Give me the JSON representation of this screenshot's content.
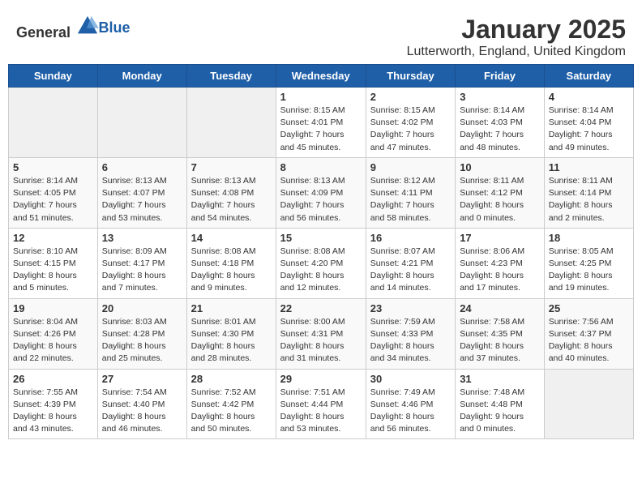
{
  "logo": {
    "general": "General",
    "blue": "Blue"
  },
  "title": "January 2025",
  "location": "Lutterworth, England, United Kingdom",
  "days_of_week": [
    "Sunday",
    "Monday",
    "Tuesday",
    "Wednesday",
    "Thursday",
    "Friday",
    "Saturday"
  ],
  "weeks": [
    [
      {
        "day": "",
        "info": ""
      },
      {
        "day": "",
        "info": ""
      },
      {
        "day": "",
        "info": ""
      },
      {
        "day": "1",
        "info": "Sunrise: 8:15 AM\nSunset: 4:01 PM\nDaylight: 7 hours\nand 45 minutes."
      },
      {
        "day": "2",
        "info": "Sunrise: 8:15 AM\nSunset: 4:02 PM\nDaylight: 7 hours\nand 47 minutes."
      },
      {
        "day": "3",
        "info": "Sunrise: 8:14 AM\nSunset: 4:03 PM\nDaylight: 7 hours\nand 48 minutes."
      },
      {
        "day": "4",
        "info": "Sunrise: 8:14 AM\nSunset: 4:04 PM\nDaylight: 7 hours\nand 49 minutes."
      }
    ],
    [
      {
        "day": "5",
        "info": "Sunrise: 8:14 AM\nSunset: 4:05 PM\nDaylight: 7 hours\nand 51 minutes."
      },
      {
        "day": "6",
        "info": "Sunrise: 8:13 AM\nSunset: 4:07 PM\nDaylight: 7 hours\nand 53 minutes."
      },
      {
        "day": "7",
        "info": "Sunrise: 8:13 AM\nSunset: 4:08 PM\nDaylight: 7 hours\nand 54 minutes."
      },
      {
        "day": "8",
        "info": "Sunrise: 8:13 AM\nSunset: 4:09 PM\nDaylight: 7 hours\nand 56 minutes."
      },
      {
        "day": "9",
        "info": "Sunrise: 8:12 AM\nSunset: 4:11 PM\nDaylight: 7 hours\nand 58 minutes."
      },
      {
        "day": "10",
        "info": "Sunrise: 8:11 AM\nSunset: 4:12 PM\nDaylight: 8 hours\nand 0 minutes."
      },
      {
        "day": "11",
        "info": "Sunrise: 8:11 AM\nSunset: 4:14 PM\nDaylight: 8 hours\nand 2 minutes."
      }
    ],
    [
      {
        "day": "12",
        "info": "Sunrise: 8:10 AM\nSunset: 4:15 PM\nDaylight: 8 hours\nand 5 minutes."
      },
      {
        "day": "13",
        "info": "Sunrise: 8:09 AM\nSunset: 4:17 PM\nDaylight: 8 hours\nand 7 minutes."
      },
      {
        "day": "14",
        "info": "Sunrise: 8:08 AM\nSunset: 4:18 PM\nDaylight: 8 hours\nand 9 minutes."
      },
      {
        "day": "15",
        "info": "Sunrise: 8:08 AM\nSunset: 4:20 PM\nDaylight: 8 hours\nand 12 minutes."
      },
      {
        "day": "16",
        "info": "Sunrise: 8:07 AM\nSunset: 4:21 PM\nDaylight: 8 hours\nand 14 minutes."
      },
      {
        "day": "17",
        "info": "Sunrise: 8:06 AM\nSunset: 4:23 PM\nDaylight: 8 hours\nand 17 minutes."
      },
      {
        "day": "18",
        "info": "Sunrise: 8:05 AM\nSunset: 4:25 PM\nDaylight: 8 hours\nand 19 minutes."
      }
    ],
    [
      {
        "day": "19",
        "info": "Sunrise: 8:04 AM\nSunset: 4:26 PM\nDaylight: 8 hours\nand 22 minutes."
      },
      {
        "day": "20",
        "info": "Sunrise: 8:03 AM\nSunset: 4:28 PM\nDaylight: 8 hours\nand 25 minutes."
      },
      {
        "day": "21",
        "info": "Sunrise: 8:01 AM\nSunset: 4:30 PM\nDaylight: 8 hours\nand 28 minutes."
      },
      {
        "day": "22",
        "info": "Sunrise: 8:00 AM\nSunset: 4:31 PM\nDaylight: 8 hours\nand 31 minutes."
      },
      {
        "day": "23",
        "info": "Sunrise: 7:59 AM\nSunset: 4:33 PM\nDaylight: 8 hours\nand 34 minutes."
      },
      {
        "day": "24",
        "info": "Sunrise: 7:58 AM\nSunset: 4:35 PM\nDaylight: 8 hours\nand 37 minutes."
      },
      {
        "day": "25",
        "info": "Sunrise: 7:56 AM\nSunset: 4:37 PM\nDaylight: 8 hours\nand 40 minutes."
      }
    ],
    [
      {
        "day": "26",
        "info": "Sunrise: 7:55 AM\nSunset: 4:39 PM\nDaylight: 8 hours\nand 43 minutes."
      },
      {
        "day": "27",
        "info": "Sunrise: 7:54 AM\nSunset: 4:40 PM\nDaylight: 8 hours\nand 46 minutes."
      },
      {
        "day": "28",
        "info": "Sunrise: 7:52 AM\nSunset: 4:42 PM\nDaylight: 8 hours\nand 50 minutes."
      },
      {
        "day": "29",
        "info": "Sunrise: 7:51 AM\nSunset: 4:44 PM\nDaylight: 8 hours\nand 53 minutes."
      },
      {
        "day": "30",
        "info": "Sunrise: 7:49 AM\nSunset: 4:46 PM\nDaylight: 8 hours\nand 56 minutes."
      },
      {
        "day": "31",
        "info": "Sunrise: 7:48 AM\nSunset: 4:48 PM\nDaylight: 9 hours\nand 0 minutes."
      },
      {
        "day": "",
        "info": ""
      }
    ]
  ]
}
